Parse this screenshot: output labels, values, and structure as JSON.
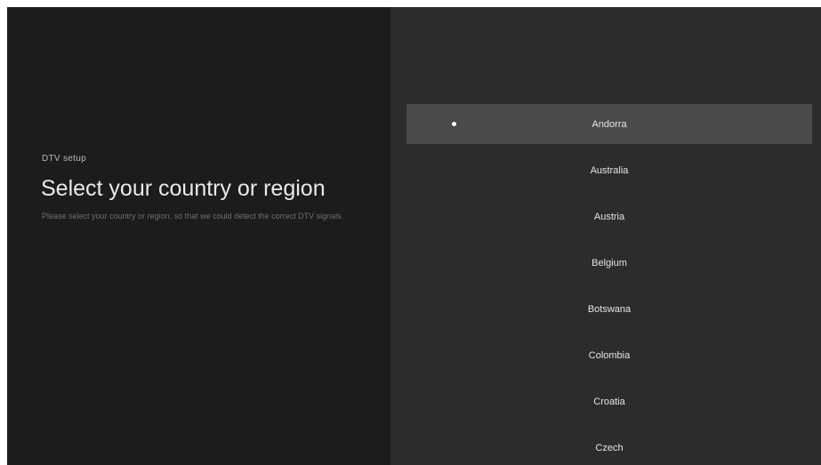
{
  "setup": {
    "subtitle": "DTV setup",
    "title": "Select your country or region",
    "description": "Please select your country or region, so that we could detect the correct DTV signals."
  },
  "countries": {
    "selected": "Andorra",
    "items": [
      {
        "label": "Andorra"
      },
      {
        "label": "Australia"
      },
      {
        "label": "Austria"
      },
      {
        "label": "Belgium"
      },
      {
        "label": "Botswana"
      },
      {
        "label": "Colombia"
      },
      {
        "label": "Croatia"
      },
      {
        "label": "Czech"
      }
    ]
  },
  "colors": {
    "left_panel": "#1c1c1c",
    "right_panel": "#2c2c2c",
    "focused_item": "#4a4a4a",
    "radio_dot": "#ffffff"
  }
}
